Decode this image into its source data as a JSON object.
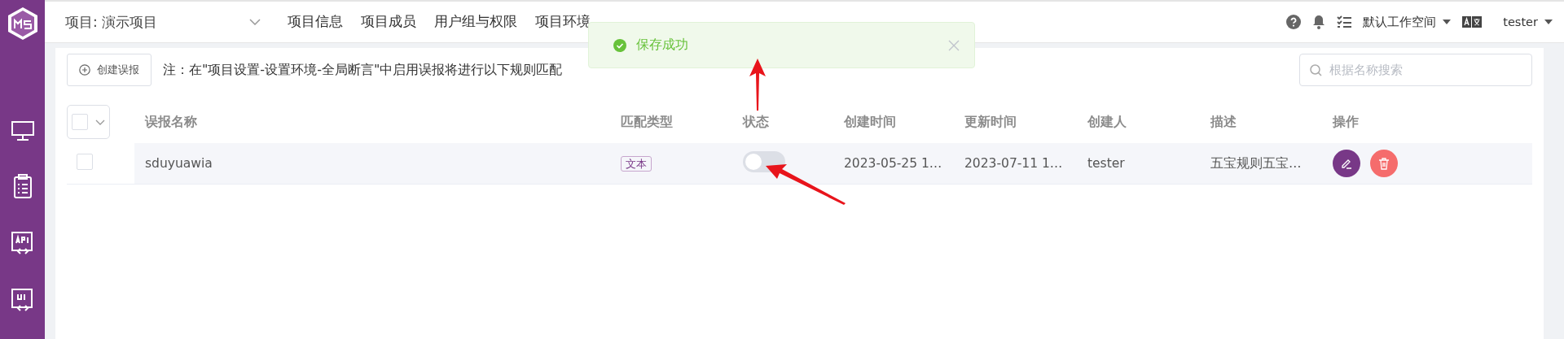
{
  "project_select": {
    "value": "项目: 演示项目"
  },
  "nav": [
    {
      "label": "项目信息"
    },
    {
      "label": "项目成员"
    },
    {
      "label": "用户组与权限"
    },
    {
      "label": "项目环境"
    }
  ],
  "header_right": {
    "workspace": "默认工作空间",
    "user": "tester"
  },
  "toast": {
    "message": "保存成功"
  },
  "toolbar": {
    "create_button": "创建误报",
    "note": "注：在\"项目设置-设置环境-全局断言\"中启用误报将进行以下规则匹配",
    "search": {
      "placeholder": "根据名称搜索"
    }
  },
  "table": {
    "select_all": {
      "checked": false
    },
    "columns": [
      "误报名称",
      "匹配类型",
      "状态",
      "创建时间",
      "更新时间",
      "创建人",
      "描述",
      "操作"
    ],
    "rows": [
      {
        "checked": false,
        "name": "sduyuawia",
        "match_type": "文本",
        "enabled": false,
        "created": "2023-05-25 1…",
        "updated": "2023-07-11 1…",
        "creator": "tester",
        "description": "五宝规则五宝…"
      }
    ]
  }
}
